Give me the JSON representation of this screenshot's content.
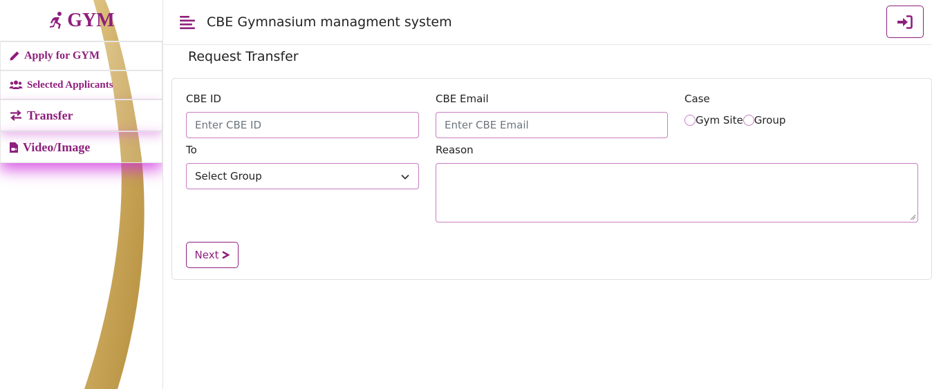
{
  "sidebar": {
    "brand": "GYM",
    "items": [
      {
        "label": "Apply for GYM",
        "icon": "pencil-icon"
      },
      {
        "label": "Selected Applicants",
        "icon": "users-icon"
      },
      {
        "label": "Transfer",
        "icon": "arrows-exchange-icon"
      },
      {
        "label": "Video/Image",
        "icon": "file-video-icon"
      }
    ]
  },
  "header": {
    "title": "CBE Gymnasium managment system",
    "menu_icon": "bars-staggered-icon",
    "login_icon": "sign-in-icon"
  },
  "page": {
    "title": "Request Transfer"
  },
  "form": {
    "cbe_id_label": "CBE ID",
    "cbe_id_placeholder": "Enter CBE ID",
    "cbe_email_label": "CBE Email",
    "cbe_email_placeholder": "Enter CBE Email",
    "case_label": "Case",
    "case_options": [
      "Gym Site",
      "Group"
    ],
    "to_label": "To",
    "to_selected": "Select Group",
    "reason_label": "Reason",
    "next_label": "Next"
  },
  "colors": {
    "accent": "#8e1f7d",
    "gold": "#c9a14e",
    "border": "#c77dc0"
  }
}
